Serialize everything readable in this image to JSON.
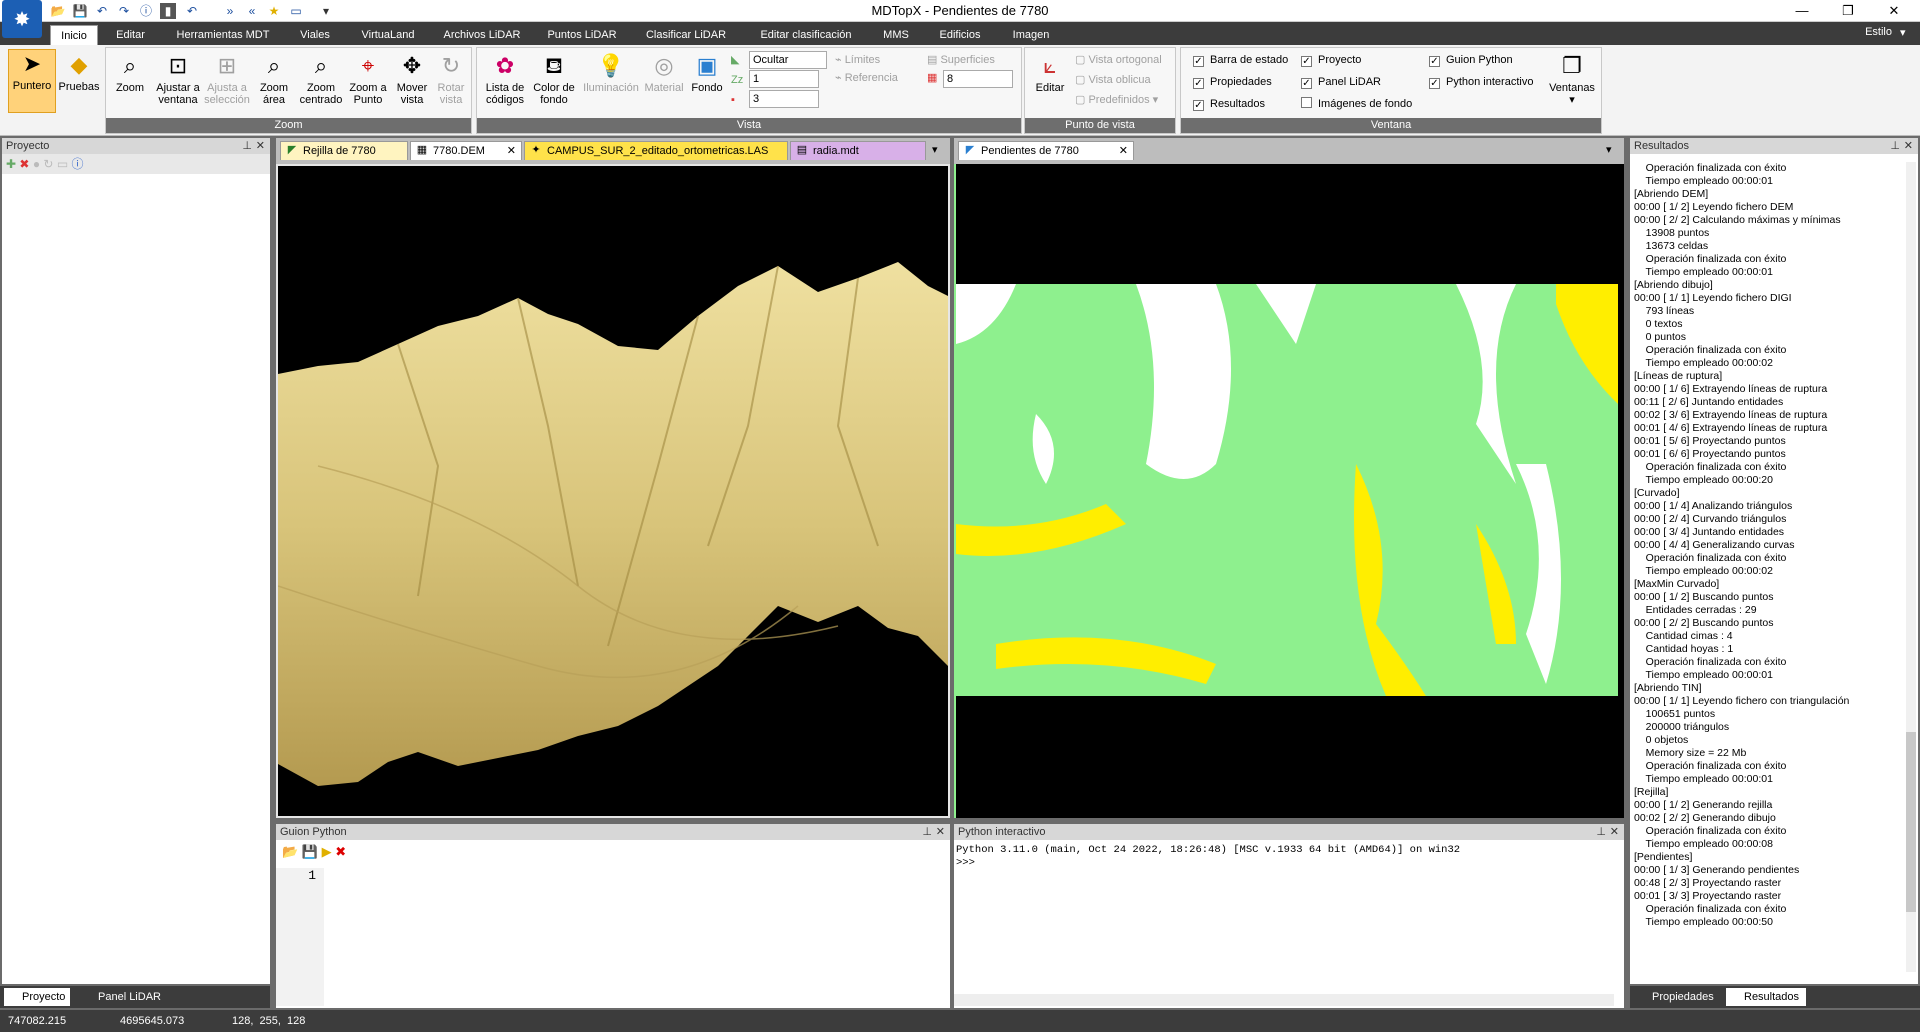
{
  "window": {
    "title": "MDTopX - Pendientes de 7780",
    "style_label": "Estilo"
  },
  "menu_tabs": [
    "Inicio",
    "Editar",
    "Herramientas MDT",
    "Viales",
    "VirtuaLand",
    "Archivos LiDAR",
    "Puntos LiDAR",
    "Clasificar LiDAR",
    "Editar clasificación",
    "MMS",
    "Edificios",
    "Imagen"
  ],
  "ribbon": {
    "puntero": "Puntero",
    "pruebas": "Pruebas",
    "zoom_group": {
      "caption": "Zoom",
      "buttons": [
        "Zoom",
        "Ajustar a ventana",
        "Ajusta a selección",
        "Zoom área",
        "Zoom centrado",
        "Zoom a Punto",
        "Mover vista",
        "Rotar vista"
      ]
    },
    "vista_group": {
      "caption": "Vista",
      "lista": "Lista de códigos",
      "color": "Color de fondo",
      "iluminacion": "Iluminación",
      "material": "Material",
      "fondo": "Fondo",
      "ocultar": "Ocultar",
      "limites": "Límites",
      "referencia": "Referencia",
      "z1": "1",
      "z3": "3",
      "superficies": "Superficies",
      "sup_val": "8"
    },
    "punto_group": {
      "caption": "Punto de vista",
      "editar": "Editar",
      "orto": "Vista ortogonal",
      "oblicua": "Vista oblicua",
      "predef": "Predefinidos"
    },
    "ventana_group": {
      "caption": "Ventana",
      "items": [
        "Barra de estado",
        "Propiedades",
        "Resultados",
        "Proyecto",
        "Panel LiDAR",
        "Imágenes de fondo",
        "Guion Python",
        "Python interactivo"
      ],
      "ventanas": "Ventanas"
    }
  },
  "project_panel": {
    "title": "Proyecto",
    "tabs": [
      "Proyecto",
      "Panel LiDAR"
    ]
  },
  "doc_tabs_left": [
    "Rejilla de 7780",
    "7780.DEM",
    "CAMPUS_SUR_2_editado_ortometricas.LAS",
    "radia.mdt"
  ],
  "doc_tabs_right": [
    "Pendientes de 7780"
  ],
  "guion": {
    "title": "Guion Python",
    "line": "1"
  },
  "python": {
    "title": "Python interactivo",
    "banner": "Python 3.11.0 (main, Oct 24 2022, 18:26:48) [MSC v.1933 64 bit (AMD64)] on win32",
    "prompt": ">>>"
  },
  "results": {
    "title": "Resultados",
    "tabs": [
      "Propiedades",
      "Resultados"
    ],
    "lines": [
      "    Operación finalizada con éxito",
      "    Tiempo empleado 00:00:01",
      "[Abriendo DEM]",
      "00:00 [ 1/ 2] Leyendo fichero DEM",
      "00:00 [ 2/ 2] Calculando máximas y mínimas",
      "    13908 puntos",
      "    13673 celdas",
      "    Operación finalizada con éxito",
      "    Tiempo empleado 00:00:01",
      "[Abriendo dibujo]",
      "00:00 [ 1/ 1] Leyendo fichero DIGI",
      "    793 líneas",
      "    0 textos",
      "    0 puntos",
      "    Operación finalizada con éxito",
      "    Tiempo empleado 00:00:02",
      "[Líneas de ruptura]",
      "00:00 [ 1/ 6] Extrayendo líneas de ruptura",
      "00:11 [ 2/ 6] Juntando entidades",
      "00:02 [ 3/ 6] Extrayendo líneas de ruptura",
      "00:01 [ 4/ 6] Extrayendo líneas de ruptura",
      "00:01 [ 5/ 6] Proyectando puntos",
      "00:01 [ 6/ 6] Proyectando puntos",
      "    Operación finalizada con éxito",
      "    Tiempo empleado 00:00:20",
      "[Curvado]",
      "00:00 [ 1/ 4] Analizando triángulos",
      "00:00 [ 2/ 4] Curvando triángulos",
      "00:00 [ 3/ 4] Juntando entidades",
      "00:00 [ 4/ 4] Generalizando curvas",
      "    Operación finalizada con éxito",
      "    Tiempo empleado 00:00:02",
      "[MaxMin Curvado]",
      "00:00 [ 1/ 2] Buscando puntos",
      "    Entidades cerradas : 29",
      "00:00 [ 2/ 2] Buscando puntos",
      "    Cantidad cimas : 4",
      "    Cantidad hoyas : 1",
      "    Operación finalizada con éxito",
      "    Tiempo empleado 00:00:01",
      "[Abriendo TIN]",
      "00:00 [ 1/ 1] Leyendo fichero con triangulación",
      "    100651 puntos",
      "    200000 triángulos",
      "    0 objetos",
      "    Memory size = 22 Mb",
      "    Operación finalizada con éxito",
      "    Tiempo empleado 00:00:01",
      "[Rejilla]",
      "00:00 [ 1/ 2] Generando rejilla",
      "00:02 [ 2/ 2] Generando dibujo",
      "    Operación finalizada con éxito",
      "    Tiempo empleado 00:00:08",
      "[Pendientes]",
      "00:00 [ 1/ 3] Generando pendientes",
      "00:48 [ 2/ 3] Proyectando raster",
      "00:01 [ 3/ 3] Proyectando raster",
      "    Operación finalizada con éxito",
      "    Tiempo empleado 00:00:50"
    ]
  },
  "status": {
    "x": "747082.215",
    "y": "4695645.073",
    "rgb": "128,  255,  128"
  },
  "colors": {
    "terrain": "#e0cd80",
    "slope_green": "#8ef08e",
    "slope_yellow": "#ffee00",
    "dark": "#3c3c3c"
  }
}
